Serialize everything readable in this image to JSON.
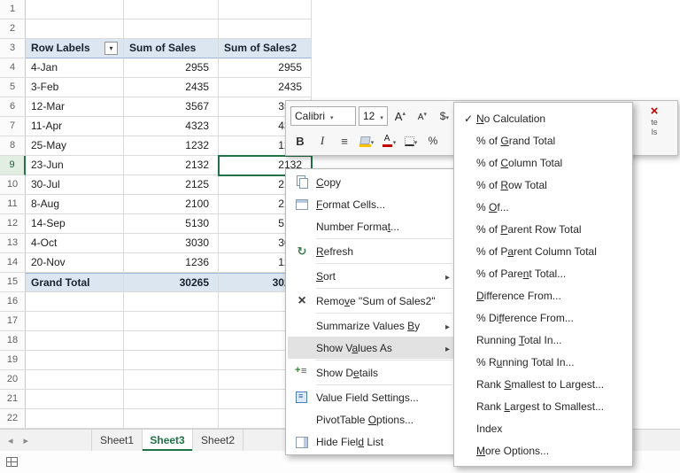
{
  "grid": {
    "row_numbers": [
      "1",
      "2",
      "3",
      "4",
      "5",
      "6",
      "7",
      "8",
      "9",
      "10",
      "11",
      "12",
      "13",
      "14",
      "15",
      "16",
      "17",
      "18",
      "19",
      "20",
      "21",
      "22"
    ],
    "selected_row": "9"
  },
  "pivot_table": {
    "columns": [
      "Row Labels",
      "Sum of Sales",
      "Sum of Sales2"
    ],
    "rows": [
      {
        "label": "4-Jan",
        "sales": "2955",
        "sales2": "2955"
      },
      {
        "label": "3-Feb",
        "sales": "2435",
        "sales2": "2435"
      },
      {
        "label": "12-Mar",
        "sales": "3567",
        "sales2": "3567"
      },
      {
        "label": "11-Apr",
        "sales": "4323",
        "sales2": "4323"
      },
      {
        "label": "25-May",
        "sales": "1232",
        "sales2": "1232"
      },
      {
        "label": "23-Jun",
        "sales": "2132",
        "sales2": "2132"
      },
      {
        "label": "30-Jul",
        "sales": "2125",
        "sales2": "2125"
      },
      {
        "label": "8-Aug",
        "sales": "2100",
        "sales2": "2100"
      },
      {
        "label": "14-Sep",
        "sales": "5130",
        "sales2": "5130"
      },
      {
        "label": "4-Oct",
        "sales": "3030",
        "sales2": "3030"
      },
      {
        "label": "20-Nov",
        "sales": "1236",
        "sales2": "1236"
      }
    ],
    "grand_total": {
      "label": "Grand Total",
      "sales": "30265",
      "sales2": "30265"
    }
  },
  "mini_toolbar": {
    "row1": [
      {
        "name": "font-name-select",
        "type": "select",
        "kind": "font",
        "label": "Calibri"
      },
      {
        "name": "font-size-select",
        "type": "select",
        "kind": "size",
        "label": "12"
      },
      {
        "name": "grow-font-button",
        "icon": "grow-font-icon"
      },
      {
        "name": "shrink-font-button",
        "icon": "shrink-font-icon"
      },
      {
        "name": "accounting-format-button",
        "glyph": "$",
        "dropdown": true
      }
    ],
    "row2": [
      {
        "name": "bold-button",
        "glyph": "B"
      },
      {
        "name": "italic-button",
        "glyph": "I"
      },
      {
        "name": "center-align-button",
        "glyph": "≡"
      },
      {
        "name": "fill-color-button",
        "icon": "fill-color-icon",
        "dropdown": true
      },
      {
        "name": "font-color-button",
        "icon": "font-color-icon",
        "dropdown": true
      },
      {
        "name": "borders-button",
        "icon": "borders-icon",
        "dropdown": true
      },
      {
        "name": "percent-style-button",
        "glyph": "%"
      }
    ],
    "overflow_fragment": {
      "lines": [
        "te",
        "ls"
      ]
    }
  },
  "context_menu": {
    "items": [
      {
        "name": "copy",
        "label": "&Copy",
        "icon": "copy-icon"
      },
      {
        "name": "format-cells",
        "label": "&Format Cells...",
        "icon": "format-cells-icon"
      },
      {
        "name": "number-format",
        "label": "Number Forma&t...",
        "sep_after": true
      },
      {
        "name": "refresh",
        "label": "&Refresh",
        "icon": "refresh-icon",
        "sep_after": true
      },
      {
        "name": "sort",
        "label": "&Sort",
        "submenu": true,
        "sep_after": true
      },
      {
        "name": "remove-sum-of-sales2",
        "label": "Remo&ve \"Sum of Sales2\"",
        "icon": "remove-icon",
        "sep_after": true
      },
      {
        "name": "summarize-values-by",
        "label": "Summarize Values &By",
        "submenu": true
      },
      {
        "name": "show-values-as",
        "label": "Show V&alues As",
        "submenu": true,
        "highlighted": true,
        "sep_after": true
      },
      {
        "name": "show-details",
        "label": "Show D&etails",
        "icon": "show-details-icon",
        "sep_after": true
      },
      {
        "name": "value-field-settings",
        "label": "Value Field Settin&gs...",
        "icon": "value-field-settings-icon"
      },
      {
        "name": "pivottable-options",
        "label": "PivotTable &Options..."
      },
      {
        "name": "hide-field-list",
        "label": "Hide Fiel&d List",
        "icon": "hide-field-list-icon"
      }
    ]
  },
  "submenu": {
    "items": [
      {
        "name": "no-calculation",
        "label": "&No Calculation",
        "checked": true
      },
      {
        "name": "percent-of-grand-total",
        "label": "% of &Grand Total"
      },
      {
        "name": "percent-of-column-total",
        "label": "% of &Column Total"
      },
      {
        "name": "percent-of-row-total",
        "label": "% of &Row Total"
      },
      {
        "name": "percent-of",
        "label": "% &Of..."
      },
      {
        "name": "percent-of-parent-row-total",
        "label": "% of &Parent Row Total"
      },
      {
        "name": "percent-of-parent-column-total",
        "label": "% of P&arent Column Total"
      },
      {
        "name": "percent-of-parent-total",
        "label": "% of Pare&nt Total..."
      },
      {
        "name": "difference-from",
        "label": "&Difference From..."
      },
      {
        "name": "percent-difference-from",
        "label": "% Di&fference From..."
      },
      {
        "name": "running-total-in",
        "label": "Running &Total In..."
      },
      {
        "name": "percent-running-total-in",
        "label": "% R&unning Total In..."
      },
      {
        "name": "rank-smallest-to-largest",
        "label": "Rank &Smallest to Largest..."
      },
      {
        "name": "rank-largest-to-smallest",
        "label": "Rank &Largest to Smallest..."
      },
      {
        "name": "index",
        "label": "Index"
      },
      {
        "name": "more-options",
        "label": "&More Options..."
      }
    ]
  },
  "sheet_tabs": {
    "tabs": [
      {
        "name": "Sheet1",
        "active": false
      },
      {
        "name": "Sheet3",
        "active": true
      },
      {
        "name": "Sheet2",
        "active": false
      }
    ]
  },
  "colors": {
    "selection_green": "#217346",
    "pivot_header_bg": "#DCE6F1",
    "accent_red": "#C00000"
  }
}
